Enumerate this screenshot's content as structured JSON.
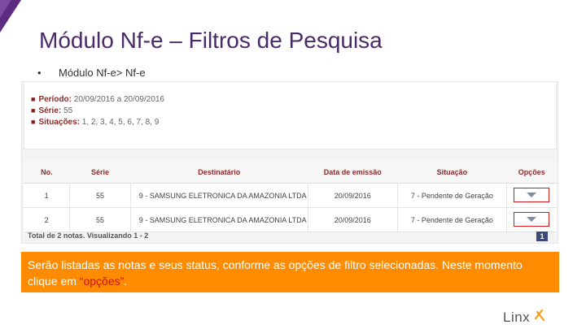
{
  "slide": {
    "title": "Módulo Nf-e – Filtros de Pesquisa",
    "bullet": "Módulo Nf-e> Nf-e"
  },
  "filters": [
    {
      "key": "Período:",
      "value": "20/09/2016 a 20/09/2016"
    },
    {
      "key": "Série:",
      "value": "55"
    },
    {
      "key": "Situações:",
      "value": "1, 2, 3, 4, 5, 6, 7, 8, 9"
    }
  ],
  "table": {
    "headers": [
      "No.",
      "Série",
      "Destinatário",
      "Data de emissão",
      "Situação",
      "Opções"
    ],
    "rows": [
      {
        "no": "1",
        "serie": "55",
        "dest": "9 - SAMSUNG ELETRONICA DA AMAZONIA LTDA",
        "data": "20/09/2016",
        "situacao": "7 - Pendente de Geração"
      },
      {
        "no": "2",
        "serie": "55",
        "dest": "9 - SAMSUNG ELETRONICA DA AMAZONIA LTDA",
        "data": "20/09/2016",
        "situacao": "7 - Pendente de Geração"
      }
    ],
    "total": "Total de 2 notas. Visualizando 1 - 2",
    "page": "1"
  },
  "callout": {
    "text": "Serão listadas as notas e seus status, conforme as opções de filtro selecionadas. Neste momento clique em ",
    "highlight": "“opções”",
    "end": "."
  },
  "logo": {
    "text": "Linx"
  },
  "colors": {
    "accent": "#ff8c00",
    "title": "#4a2a6a",
    "highlight_box": "#d41b1b",
    "logo_mark": "#f39c12"
  }
}
